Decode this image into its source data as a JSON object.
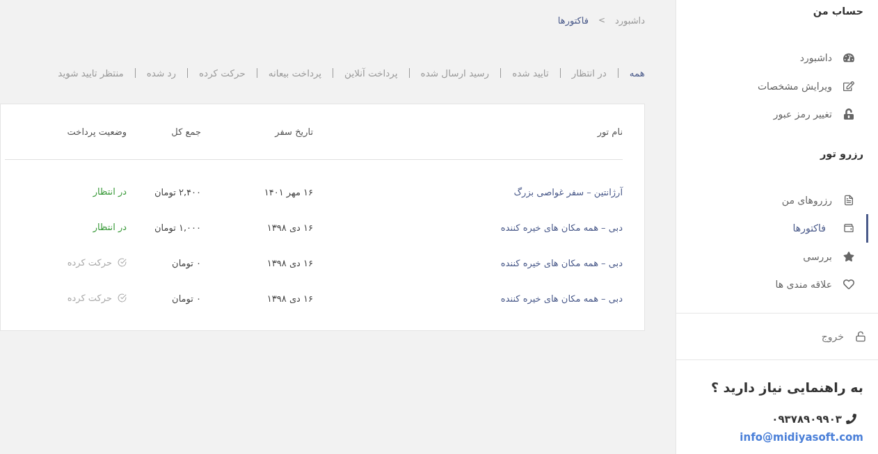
{
  "breadcrumb": [
    {
      "label": "داشبورد",
      "current": false
    },
    {
      "label": "فاکتورها",
      "current": true
    }
  ],
  "breadcrumb_separator": ">",
  "filters": [
    {
      "label": "همه",
      "selected": true
    },
    {
      "label": "در انتظار",
      "selected": false
    },
    {
      "label": "تایید شده",
      "selected": false
    },
    {
      "label": "رسید ارسال شده",
      "selected": false
    },
    {
      "label": "پرداخت آنلاین",
      "selected": false
    },
    {
      "label": "پرداخت بیعانه",
      "selected": false
    },
    {
      "label": "حرکت کرده",
      "selected": false
    },
    {
      "label": "رد شده",
      "selected": false
    },
    {
      "label": "منتظر تایید شوید",
      "selected": false
    }
  ],
  "table": {
    "columns": [
      "نام تور",
      "تاریخ سفر",
      "جمع کل",
      "وضعیت پرداخت"
    ],
    "rows": [
      {
        "tour": "آرژانتین – سفر غواصی بزرگ",
        "date": "۱۶ مهر ۱۴۰۱",
        "total": "۲,۴۰۰ تومان",
        "status": {
          "label": "در انتظار",
          "kind": "pending"
        }
      },
      {
        "tour": "دبی – همه مکان های خیره کننده",
        "date": "۱۶ دی ۱۳۹۸",
        "total": "۱,۰۰۰ تومان",
        "status": {
          "label": "در انتظار",
          "kind": "pending"
        }
      },
      {
        "tour": "دبی – همه مکان های خیره کننده",
        "date": "۱۶ دی ۱۳۹۸",
        "total": "۰ تومان",
        "status": {
          "label": "حرکت کرده",
          "kind": "departed"
        }
      },
      {
        "tour": "دبی – همه مکان های خیره کننده",
        "date": "۱۶ دی ۱۳۹۸",
        "total": "۰ تومان",
        "status": {
          "label": "حرکت کرده",
          "kind": "departed"
        }
      }
    ]
  },
  "sidebar": {
    "sections": [
      {
        "title": "حساب من",
        "items": [
          {
            "label": "داشبورد",
            "selected": false
          },
          {
            "label": "ویرایش مشخصات",
            "selected": false
          },
          {
            "label": "تغییر رمز عبور",
            "selected": false
          }
        ]
      },
      {
        "title": "رزرو تور",
        "items": [
          {
            "label": "رزروهای من",
            "selected": false
          },
          {
            "label": "فاکتورها",
            "selected": true
          },
          {
            "label": "بررسی",
            "selected": false
          },
          {
            "label": "علاقه مندی ها",
            "selected": false
          }
        ]
      }
    ],
    "logout": "خروج",
    "help": {
      "title": "به راهنمایی نیاز دارید ؟",
      "phone": "۰۹۳۷۸۹۰۹۹۰۳",
      "email": "info@midiyasoft.com"
    }
  }
}
